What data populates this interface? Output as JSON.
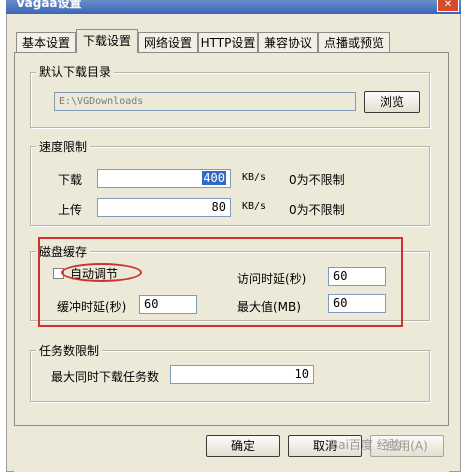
{
  "window": {
    "title": "Vagaa设置",
    "close_glyph": "✕"
  },
  "tabs": [
    {
      "label": "基本设置",
      "active": false
    },
    {
      "label": "下载设置",
      "active": true
    },
    {
      "label": "网络设置",
      "active": false
    },
    {
      "label": "HTTP设置",
      "active": false
    },
    {
      "label": "兼容协议",
      "active": false
    },
    {
      "label": "点播或预览",
      "active": false
    }
  ],
  "download_dir": {
    "title": "默认下载目录",
    "path": "E:\\VGDownloads",
    "browse_label": "浏览"
  },
  "speed_limit": {
    "title": "速度限制",
    "download_label": "下载",
    "download_value": "400",
    "upload_label": "上传",
    "upload_value": "80",
    "unit": "KB/s",
    "note": "0为不限制"
  },
  "disk_cache": {
    "title": "磁盘缓存",
    "auto_adjust_label": "自动调节",
    "auto_adjust_checked": false,
    "access_delay_label": "访问时延(秒)",
    "access_delay_value": "60",
    "buffer_delay_label": "缓冲时延(秒)",
    "buffer_delay_value": "60",
    "max_size_label": "最大值(MB)",
    "max_size_value": "60"
  },
  "task_limit": {
    "title": "任务数限制",
    "max_concurrent_label": "最大同时下载任务数",
    "max_concurrent_value": "10"
  },
  "buttons": {
    "ok": "确定",
    "cancel": "取消",
    "apply": "应用(A)"
  },
  "watermark": "Bai百度 经验",
  "highlight_color": "#d0312d"
}
